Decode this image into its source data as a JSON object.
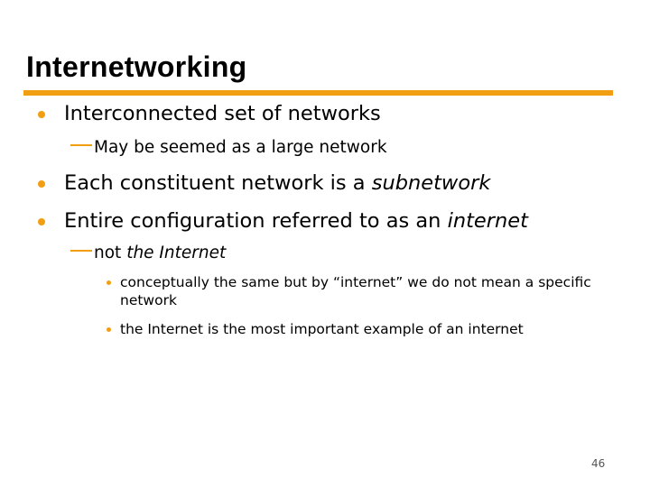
{
  "slide": {
    "title": "Internetworking",
    "accent_color": "#f29e12",
    "bullets": [
      {
        "text": "Interconnected set of networks",
        "sub": [
          "May be seemed as a large network"
        ]
      },
      {
        "text_plain": "Each constituent network is a ",
        "text_italic": "subnetwork"
      },
      {
        "text_plain": "Entire configuration referred to as an ",
        "text_italic": "internet",
        "sub": [
          {
            "text_plain": "not ",
            "text_italic": "the Internet",
            "sub": [
              "conceptually the same but by “internet” we do not mean a specific network",
              "the Internet is the most important example of an internet"
            ]
          }
        ]
      }
    ],
    "page_number": "46"
  }
}
